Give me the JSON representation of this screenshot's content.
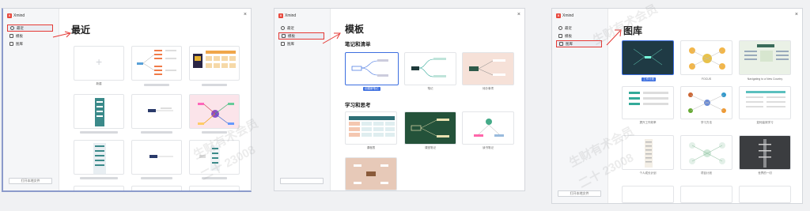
{
  "app": {
    "name": "Xmind",
    "open_local": "打开本地文件"
  },
  "nav_items": [
    {
      "label": "最近"
    },
    {
      "label": "模板"
    },
    {
      "label": "图库"
    }
  ],
  "panel_recent": {
    "title": "最近",
    "selected_index": 0,
    "new_label": "新建"
  },
  "panel_templates": {
    "title": "模板",
    "selected_index": 1,
    "sections": [
      {
        "heading": "笔记和清单",
        "items": [
          {
            "label": "创建新笔记"
          },
          {
            "label": "笔记"
          },
          {
            "label": "待办事项"
          }
        ]
      },
      {
        "heading": "学习和思考",
        "items": [
          {
            "label": "课程表"
          },
          {
            "label": "课堂笔记"
          },
          {
            "label": "读书笔记"
          }
        ]
      }
    ]
  },
  "panel_gallery": {
    "title": "图库",
    "selected_index": 2,
    "items": [
      {
        "label": "工作计划"
      },
      {
        "label": "FOCUS"
      },
      {
        "label": "Navigating to a New Country"
      },
      {
        "label": "提升工作效率"
      },
      {
        "label": "学习方法"
      },
      {
        "label": "如何高效学习"
      },
      {
        "label": "个人成长计划"
      },
      {
        "label": "项目计划"
      },
      {
        "label": "世界的一切"
      }
    ]
  },
  "watermarks": [
    "生财有术会员",
    "二十 23008"
  ],
  "colors": {
    "accent": "#3d6fe0",
    "highlight": "#e53935",
    "brand": "#e8473c"
  }
}
